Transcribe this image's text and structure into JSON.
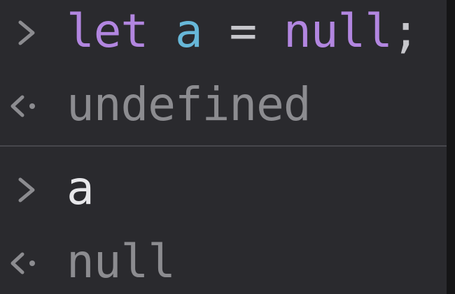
{
  "console": {
    "entries": [
      {
        "type": "input",
        "prompt_icon": "chevron-right-icon",
        "tokens": {
          "keyword": "let",
          "space1": " ",
          "var": "a",
          "space2": " ",
          "op": "=",
          "space3": " ",
          "null": "null",
          "punct": ";"
        }
      },
      {
        "type": "output",
        "return_icon": "return-arrow-icon",
        "text": "undefined"
      },
      {
        "type": "input",
        "prompt_icon": "chevron-right-icon",
        "text": "a"
      },
      {
        "type": "output",
        "return_icon": "return-arrow-icon",
        "text": "null"
      }
    ]
  },
  "colors": {
    "background": "#2a2a2e",
    "keyword": "#b286e0",
    "variable": "#67b7d8",
    "operator": "#c7c7cc",
    "input_text": "#e7e7ea",
    "result_text": "#8c8c90",
    "divider": "#47474c"
  }
}
